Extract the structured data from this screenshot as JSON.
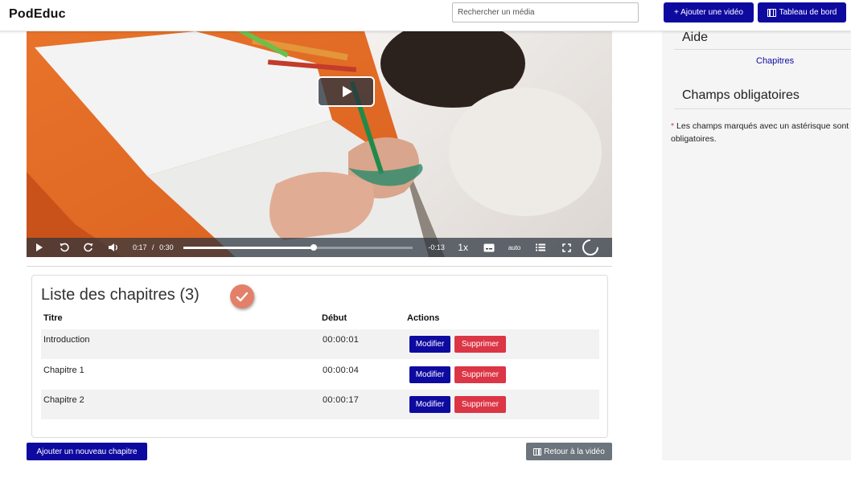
{
  "header": {
    "brand": "PodEduc",
    "search_placeholder": "Rechercher un média",
    "add_video_label": "+ Ajouter une vidéo",
    "dashboard_label": "Tableau de bord"
  },
  "player": {
    "current_time": "0:17",
    "separator": "/",
    "duration": "0:30",
    "remaining": "-0:13",
    "progress_fraction": 0.57,
    "playback_rate": "1x",
    "quality": "auto"
  },
  "chapters": {
    "title": "Liste des chapitres (3)",
    "col_title": "Titre",
    "col_start": "Début",
    "col_actions": "Actions",
    "edit_label": "Modifier",
    "delete_label": "Supprimer",
    "rows": [
      {
        "title": "Introduction",
        "start": "00:00:01"
      },
      {
        "title": "Chapitre 1",
        "start": "00:00:04"
      },
      {
        "title": "Chapitre 2",
        "start": "00:00:17"
      }
    ]
  },
  "footer": {
    "add_chapter_label": "Ajouter un nouveau chapitre",
    "back_label": "Retour à la vidéo"
  },
  "sidebar": {
    "help_title": "Aide",
    "help_link": "Chapitres",
    "required_title": "Champs obligatoires",
    "required_star": "*",
    "required_text": "Les champs marqués avec un astérisque sont obligatoires."
  },
  "colors": {
    "primary": "#0e0aa0",
    "danger": "#dc3545",
    "secondary": "#6c757d",
    "check": "#e4806a"
  }
}
